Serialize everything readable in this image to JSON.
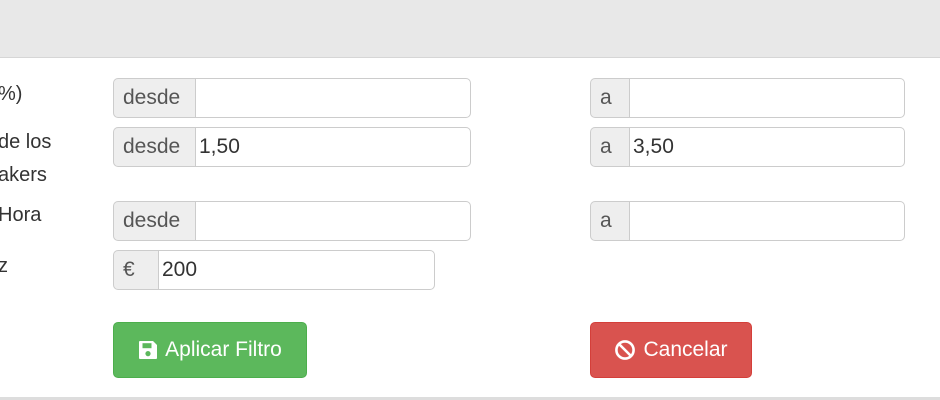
{
  "filter": {
    "rows": [
      {
        "label_lines": [
          "%)"
        ],
        "from": {
          "prefix": "desde",
          "value": ""
        },
        "to": {
          "prefix": "a",
          "value": ""
        }
      },
      {
        "label_lines": [
          "de los",
          "akers"
        ],
        "from": {
          "prefix": "desde",
          "value": "1,50"
        },
        "to": {
          "prefix": "a",
          "value": "3,50"
        }
      },
      {
        "label_lines": [
          "Hora"
        ],
        "from": {
          "prefix": "desde",
          "value": ""
        },
        "to": {
          "prefix": "a",
          "value": ""
        }
      },
      {
        "label_lines": [
          "z"
        ],
        "amount": {
          "prefix": "€",
          "value": "200"
        }
      }
    ],
    "apply_button": {
      "label": "Aplicar Filtro",
      "icon": "save-icon",
      "color": "#5cb85c"
    },
    "cancel_button": {
      "label": "Cancelar",
      "icon": "ban-icon",
      "color": "#d9534f"
    }
  }
}
